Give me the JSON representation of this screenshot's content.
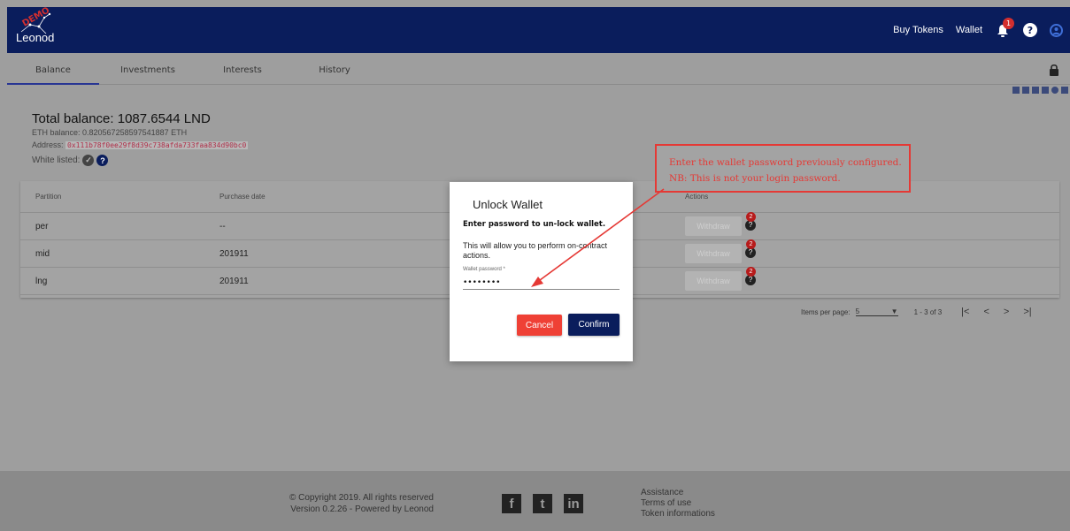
{
  "app": {
    "logo_text": "Leonod",
    "demo_stamp": "DEMO"
  },
  "header": {
    "buy_tokens": "Buy Tokens",
    "wallet": "Wallet",
    "notifications_count": "1",
    "help_icon": "question-circle-icon",
    "account_icon": "account-circle-icon",
    "colors": {
      "navbar": "#0a1d5c",
      "badge": "#d32f2f"
    }
  },
  "tabs": [
    "Balance",
    "Investments",
    "Interests",
    "History"
  ],
  "balance": {
    "total": "Total balance: 1087.6544 LND",
    "eth": "ETH balance: 0.820567258597541887 ETH",
    "address_label": "Address:",
    "address_value": "0x111b78f0ee29f8d39c738afda733faa834d90bc0",
    "white_listed_label": "White listed:"
  },
  "table": {
    "columns": [
      "Partition",
      "Purchase date",
      "Actions"
    ],
    "rows": [
      {
        "partition": "per",
        "purchase_date": "--",
        "action": "Withdraw",
        "badge": "2"
      },
      {
        "partition": "mid",
        "purchase_date": "201911",
        "action": "Withdraw",
        "badge": "2"
      },
      {
        "partition": "lng",
        "purchase_date": "201911",
        "action": "Withdraw",
        "badge": "2"
      }
    ]
  },
  "pagination": {
    "items_per_page_label": "Items per page:",
    "items_per_page": "5",
    "range": "1 - 3 of 3",
    "first": "|<",
    "prev": "<",
    "next": ">",
    "last": ">|"
  },
  "dialog": {
    "title": "Unlock Wallet",
    "subtitle": "Enter password to un-lock wallet.",
    "body": "This will allow you to perform on-contract actions.",
    "password_label": "Wallet password *",
    "password_value": "••••••••",
    "cancel": "Cancel",
    "confirm": "Confirm",
    "colors": {
      "cancel": "#ef4035",
      "confirm": "#0a1d5c"
    }
  },
  "annotation": {
    "line1": "Enter the wallet password previously configured.",
    "line2": "NB: This is not your login password.",
    "color": "#e53935"
  },
  "footer": {
    "copyright": "© Copyright 2019. All rights reserved",
    "version": "Version 0.2.26 - Powered by Leonod",
    "social": {
      "facebook": "f",
      "twitter": "t",
      "linkedin": "in"
    },
    "links": [
      "Assistance",
      "Terms of use",
      "Token informations"
    ]
  }
}
